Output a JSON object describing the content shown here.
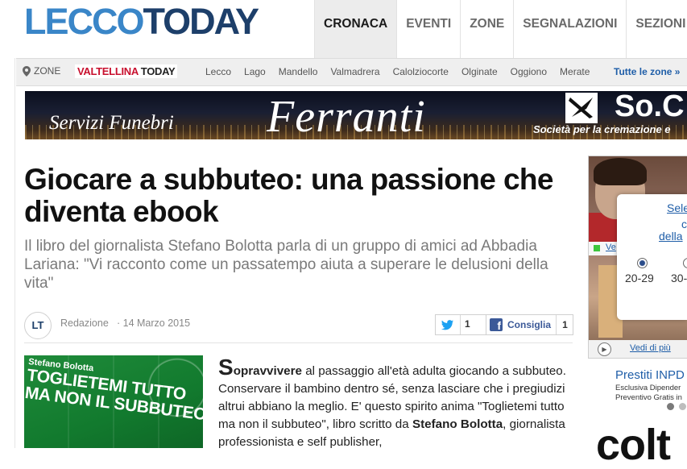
{
  "logo": {
    "part1": "LECCO",
    "part2": "TODAY"
  },
  "nav": {
    "items": [
      "CRONACA",
      "EVENTI",
      "ZONE",
      "SEGNALAZIONI",
      "SEZIONI"
    ],
    "active": "CRONACA"
  },
  "zonebar": {
    "label": "ZONE",
    "partner": {
      "part1": "VALTELLINA",
      "part2": "TODAY"
    },
    "zones": [
      "Lecco",
      "Lago",
      "Mandello",
      "Valmadrera",
      "Calolziocorte",
      "Olginate",
      "Oggiono",
      "Merate"
    ],
    "all_link": "Tutte le zone »"
  },
  "banner": {
    "servizi": "Servizi Funebri",
    "brand": "Ferranti",
    "so": "So.C",
    "tagline": "Società per la cremazione e"
  },
  "article": {
    "title": "Giocare a subbuteo: una passione che diventa ebook",
    "subtitle": "Il libro del giornalista Stefano Bolotta parla di un gruppo di amici ad Abbadia Lariana: \"Vi racconto come un passatempo aiuta a superare le delusioni della vita\"",
    "avatar_initials": "LT",
    "author": "Redazione",
    "date": "· 14 Marzo 2015",
    "twitter_count": "1",
    "facebook_label": "Consiglia",
    "facebook_count": "1",
    "book": {
      "author": "Stefano Bolotta",
      "title_line1": "TOGLIETEMI TUTTO",
      "title_line2": "MA NON IL SUBBUTEO"
    },
    "body": {
      "dropcap": "S",
      "lead_bold": "opravvivere",
      "text1": " al passaggio all'età adulta giocando a subbuteo. Conservare il bambino dentro sé, senza lasciare che i pregiudizi altrui abbiano la meglio. E' questo spirito anima \"Toglietemi tutto ma non il subbuteo\", libro scritto da ",
      "author_bold": "Stefano Bolotta",
      "text2": ", giornalista professionista e self publisher,"
    }
  },
  "sidebar": {
    "video_link": "Ve",
    "vedi_di_piu": "Vedi di più",
    "popup": {
      "select": "Sele",
      "c": "c",
      "della": "della",
      "age1": "20-29",
      "age2": "30-"
    },
    "prestiti_title": "Prestiti INPD",
    "prestiti_line1": "Esclusiva Dipender",
    "prestiti_line2": "Preventivo Gratis in",
    "bottom_text": "colt"
  },
  "colors": {
    "logo_light": "#3a86c8",
    "logo_dark": "#1d3f6a",
    "link_blue": "#1f5ea8",
    "valtellina_red": "#c8102e",
    "facebook_blue": "#3b5998",
    "twitter_blue": "#1da1f2"
  }
}
